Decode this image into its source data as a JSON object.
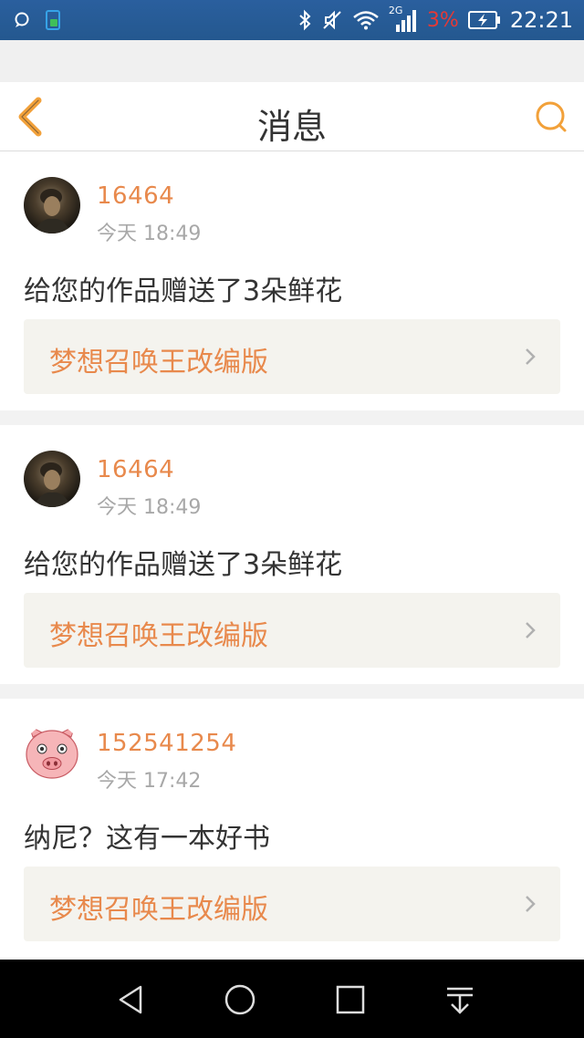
{
  "status_bar": {
    "network": "2G",
    "battery_pct": "3%",
    "time": "22:21",
    "icons": [
      "chat-icon",
      "app-notification-icon",
      "bluetooth-icon",
      "mute-icon",
      "wifi-icon",
      "signal-icon",
      "battery-charging-icon"
    ]
  },
  "header": {
    "title": "消息",
    "back_icon": "chevron-left-icon",
    "search_icon": "search-icon",
    "accent": "#f2a13a"
  },
  "messages": [
    {
      "username": "16464",
      "time": "今天 18:49",
      "text": "给您的作品赠送了3朵鲜花",
      "book": "梦想召唤王改编版",
      "avatar": "photo-avatar"
    },
    {
      "username": "16464",
      "time": "今天 18:49",
      "text": "给您的作品赠送了3朵鲜花",
      "book": "梦想召唤王改编版",
      "avatar": "photo-avatar"
    },
    {
      "username": "152541254",
      "time": "今天 17:42",
      "text": "纳尼？这有一本好书",
      "book": "梦想召唤王改编版",
      "avatar": "pig-avatar"
    }
  ],
  "colors": {
    "username": "#e8894c",
    "status_bar": "#2a5f9e",
    "book_bg": "#f4f3ee"
  },
  "system_nav": [
    "back-triangle-icon",
    "home-circle-icon",
    "recents-square-icon",
    "notification-pull-icon"
  ]
}
